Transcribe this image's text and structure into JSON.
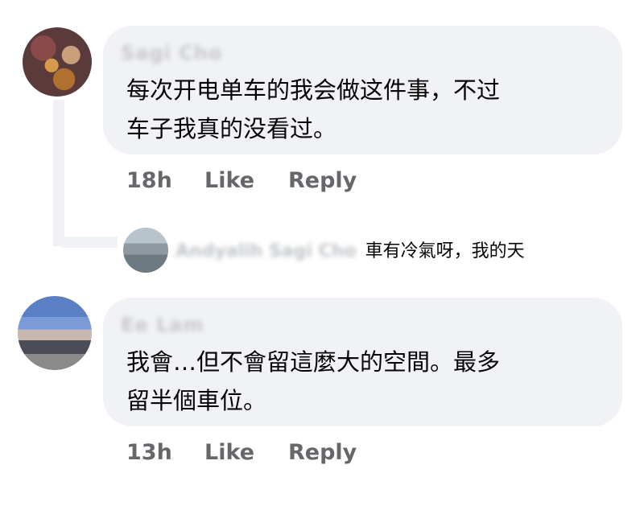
{
  "comments": [
    {
      "author": "Sagi Cho",
      "text_line1": "每次开电单车的我会做这件事，不过",
      "text_line2": "车子我真的没看过。",
      "time": "18h",
      "like_label": "Like",
      "reply_label": "Reply",
      "reply_preview": {
        "author": "Andyalih Sagi Cho",
        "text": "車有冷氣呀，我的天"
      }
    },
    {
      "author": "Ee Lam",
      "text_line1": "我會…但不會留這麼大的空間。最多",
      "text_line2": "留半個車位。",
      "time": "13h",
      "like_label": "Like",
      "reply_label": "Reply"
    }
  ]
}
